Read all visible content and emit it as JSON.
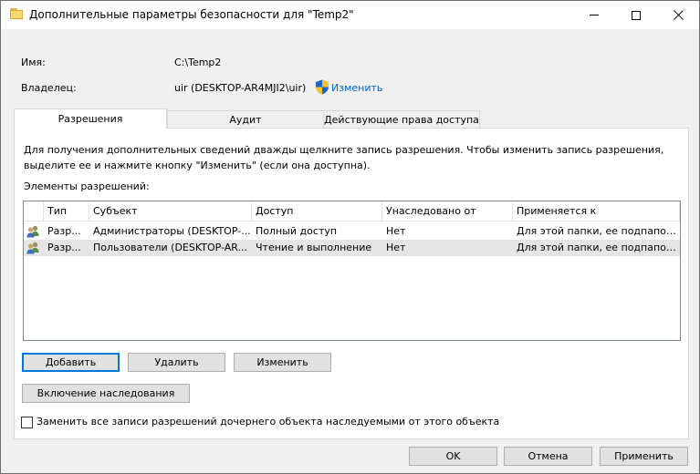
{
  "window": {
    "title": "Дополнительные параметры безопасности  для \"Temp2\""
  },
  "header": {
    "name_label": "Имя:",
    "name_value": "C:\\Temp2",
    "owner_label": "Владелец:",
    "owner_value": "uir (DESKTOP-AR4MJI2\\uir)",
    "change_owner_link": "Изменить"
  },
  "tabs": [
    {
      "label": "Разрешения",
      "active": true
    },
    {
      "label": "Аудит",
      "active": false
    },
    {
      "label": "Действующие права доступа",
      "active": false
    }
  ],
  "permissions": {
    "description": "Для получения дополнительных сведений дважды щелкните запись разрешения. Чтобы изменить запись разрешения, выделите ее и нажмите кнопку \"Изменить\" (если она доступна).",
    "elements_label": "Элементы разрешений:",
    "columns": [
      "Тип",
      "Субъект",
      "Доступ",
      "Унаследовано от",
      "Применяется к"
    ],
    "rows": [
      {
        "icon": "users-icon",
        "type": "Разр...",
        "principal": "Администраторы (DESKTOP-...",
        "access": "Полный доступ",
        "inherited": "Нет",
        "applies": "Для этой папки, ее подпапок..."
      },
      {
        "icon": "users-icon",
        "type": "Разр...",
        "principal": "Пользователи (DESKTOP-AR...",
        "access": "Чтение и выполнение",
        "inherited": "Нет",
        "applies": "Для этой папки, ее подпапок...",
        "selected": true
      }
    ],
    "add_button": "Добавить",
    "remove_button": "Удалить",
    "edit_button": "Изменить",
    "enable_inheritance_button": "Включение наследования",
    "replace_checkbox_label": "Заменить все записи разрешений дочернего объекта наследуемыми от этого объекта",
    "replace_checked": false
  },
  "footer": {
    "ok": "OK",
    "cancel": "Отмена",
    "apply": "Применить"
  },
  "colors": {
    "accent": "#0078d7",
    "link": "#0066cc",
    "selection": "#e5e5e5"
  }
}
